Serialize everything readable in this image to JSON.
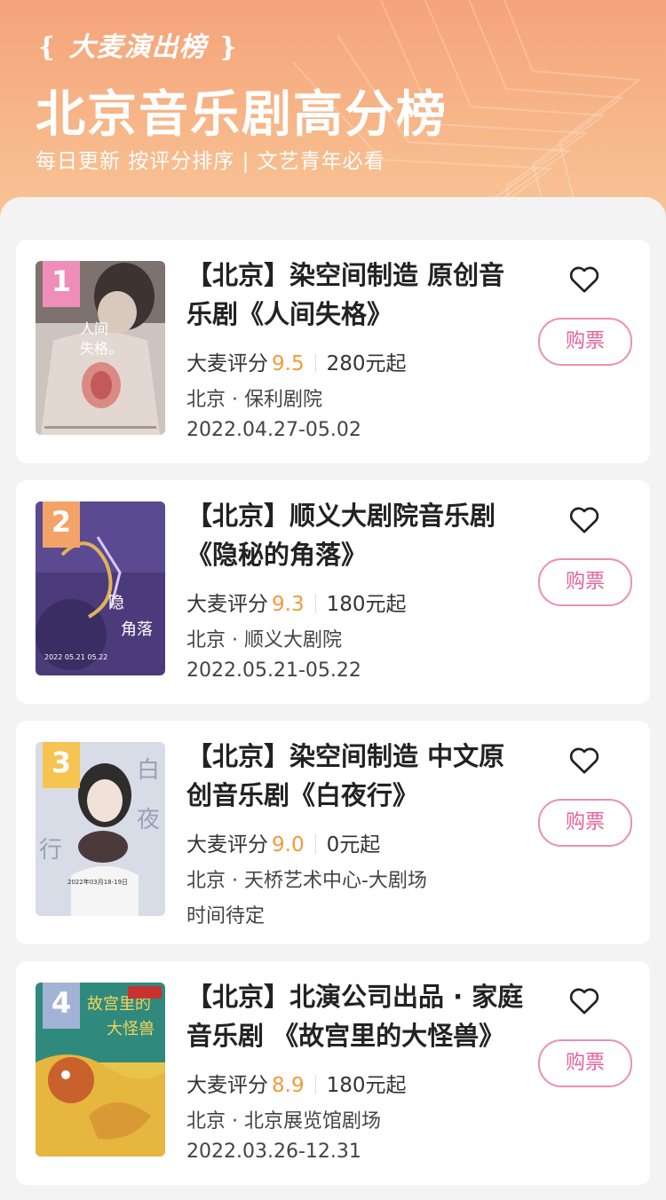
{
  "header": {
    "brand": "大麦演出榜",
    "title": "北京音乐剧高分榜",
    "subtitle": "每日更新 按评分排序 | 文艺青年必看"
  },
  "colors": {
    "header_gradient_top": "#f5a37a",
    "rating_accent": "#f29a3b",
    "buy_button": "#e8609a",
    "rank_1": "#f08dbb",
    "rank_2": "#f3a368",
    "rank_3": "#f5c451",
    "rank_4": "#a3b3d6"
  },
  "ranking": [
    {
      "rank": "1",
      "title": "【北京】染空间制造 原创音乐剧《人间失格》",
      "rating_label": "大麦评分",
      "rating": "9.5",
      "price": "280元起",
      "venue": "北京 · 保利剧院",
      "dates": "2022.04.27-05.02",
      "buy_label": "购票",
      "poster_icon": "poster-ningen-shikkaku"
    },
    {
      "rank": "2",
      "title": "【北京】顺义大剧院音乐剧《隐秘的角落》",
      "rating_label": "大麦评分",
      "rating": "9.3",
      "price": "180元起",
      "venue": "北京 · 顺义大剧院",
      "dates": "2022.05.21-05.22",
      "buy_label": "购票",
      "poster_icon": "poster-hidden-corner"
    },
    {
      "rank": "3",
      "title": "【北京】染空间制造 中文原创音乐剧《白夜行》",
      "rating_label": "大麦评分",
      "rating": "9.0",
      "price": "0元起",
      "venue": "北京 · 天桥艺术中心-大剧场",
      "dates": "时间待定",
      "buy_label": "购票",
      "poster_icon": "poster-byakuyakou"
    },
    {
      "rank": "4",
      "title": "【北京】北演公司出品 · 家庭音乐剧 《故宫里的大怪兽》",
      "rating_label": "大麦评分",
      "rating": "8.9",
      "price": "180元起",
      "venue": "北京 · 北京展览馆剧场",
      "dates": "2022.03.26-12.31",
      "buy_label": "购票",
      "poster_icon": "poster-palace-monster"
    }
  ]
}
